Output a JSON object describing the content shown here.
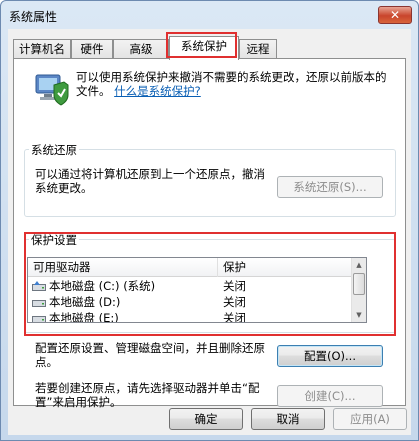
{
  "window": {
    "title": "系统属性",
    "close_glyph": "✕"
  },
  "tabs": [
    {
      "label": "计算机名"
    },
    {
      "label": "硬件"
    },
    {
      "label": "高级"
    },
    {
      "label": "系统保护"
    },
    {
      "label": "远程"
    }
  ],
  "intro": {
    "text": "可以使用系统保护来撤消不需要的系统更改，还原以前版本的文件。",
    "link": "什么是系统保护?"
  },
  "restore": {
    "group_label": "系统还原",
    "description": "可以通过将计算机还原到上一个还原点，撤消系统更改。",
    "button": "系统还原(S)..."
  },
  "protection": {
    "group_label": "保护设置",
    "columns": [
      "可用驱动器",
      "保护"
    ],
    "rows": [
      {
        "drive": "本地磁盘 (C:) (系统)",
        "status": "关闭",
        "icon": "system-drive-icon"
      },
      {
        "drive": "本地磁盘 (D:)",
        "status": "关闭",
        "icon": "drive-icon"
      },
      {
        "drive": "本地磁盘 (E:)",
        "status": "关闭",
        "icon": "drive-icon"
      }
    ],
    "configure_text": "配置还原设置、管理磁盘空间，并且删除还原点。",
    "configure_button": "配置(O)...",
    "create_text": "若要创建还原点，请先选择驱动器并单击“配置”来启用保护。",
    "create_button": "创建(C)..."
  },
  "footer": {
    "ok": "确定",
    "cancel": "取消",
    "apply": "应用(A)"
  },
  "colors": {
    "highlight_red": "#e03030",
    "link": "#0a5fb4"
  }
}
